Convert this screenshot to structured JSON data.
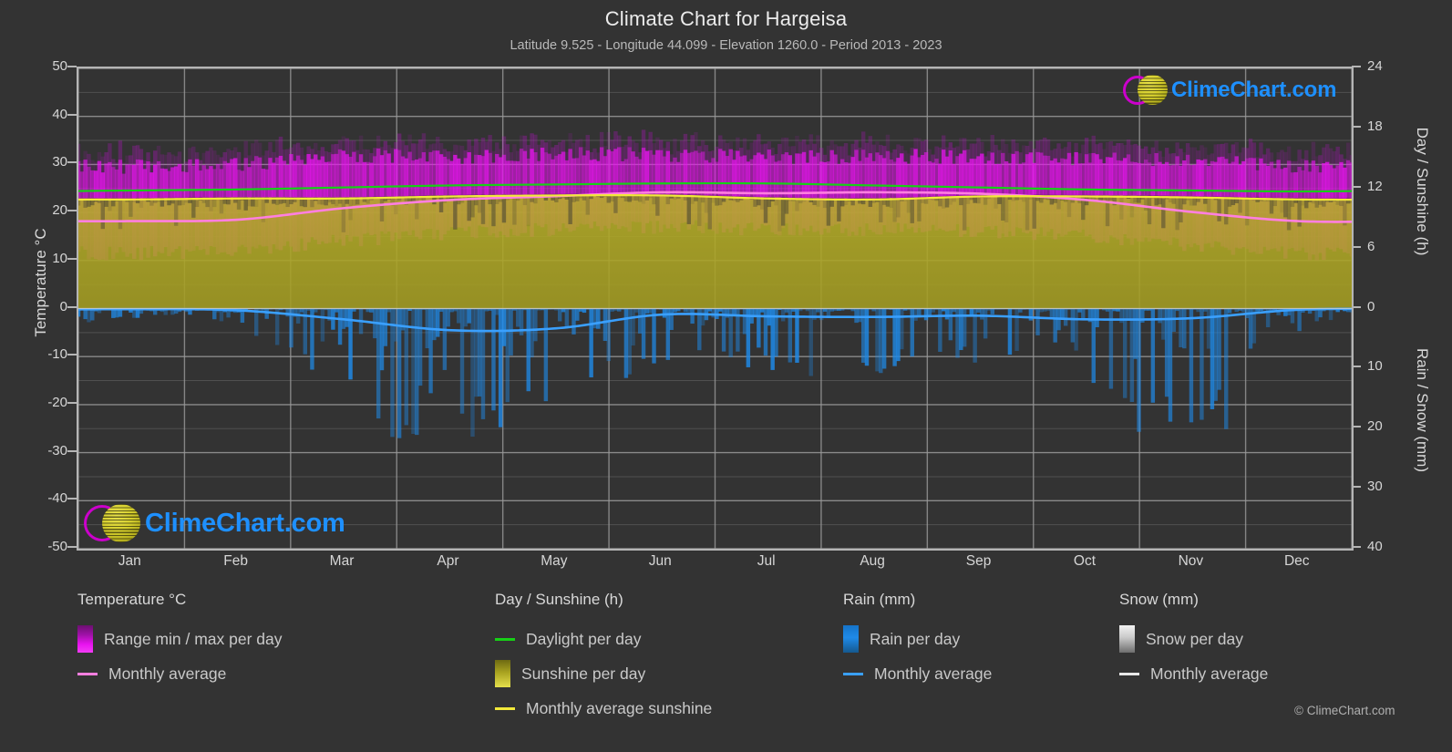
{
  "header": {
    "title": "Climate Chart for Hargeisa",
    "subtitle": "Latitude 9.525 - Longitude 44.099 - Elevation 1260.0 - Period 2013 - 2023"
  },
  "axes": {
    "left_title": "Temperature °C",
    "right_top_title": "Day / Sunshine (h)",
    "right_bottom_title": "Rain / Snow (mm)"
  },
  "legend": {
    "temperature": {
      "heading": "Temperature °C",
      "items": [
        {
          "label": "Range min / max per day",
          "marker": "swatch",
          "color": "#e913f0"
        },
        {
          "label": "Monthly average",
          "marker": "line",
          "color": "#ff7fe0"
        }
      ]
    },
    "day_sunshine": {
      "heading": "Day / Sunshine (h)",
      "items": [
        {
          "label": "Daylight per day",
          "marker": "line",
          "color": "#16d016"
        },
        {
          "label": "Sunshine per day",
          "marker": "swatch",
          "color": "#b3ac23"
        },
        {
          "label": "Monthly average sunshine",
          "marker": "line",
          "color": "#f2e93a"
        }
      ]
    },
    "rain": {
      "heading": "Rain (mm)",
      "items": [
        {
          "label": "Rain per day",
          "marker": "swatch",
          "color": "#1f8ae8"
        },
        {
          "label": "Monthly average",
          "marker": "line",
          "color": "#3aa0ff"
        }
      ]
    },
    "snow": {
      "heading": "Snow (mm)",
      "items": [
        {
          "label": "Snow per day",
          "marker": "swatch",
          "color": "#dddddd"
        },
        {
          "label": "Monthly average",
          "marker": "line",
          "color": "#e8e8e8"
        }
      ]
    }
  },
  "watermark": {
    "text": "ClimeChart.com",
    "copyright": "© ClimeChart.com"
  },
  "chart_data": {
    "type": "area",
    "title": "Climate Chart for Hargeisa",
    "subtitle": "Latitude 9.525 - Longitude 44.099 - Elevation 1260.0 - Period 2013 - 2023",
    "location": "Hargeisa",
    "latitude": 9.525,
    "longitude": 44.099,
    "elevation": 1260.0,
    "period": "2013 - 2023",
    "grid": true,
    "legend_position": "bottom",
    "xlabel": "",
    "x_tick_labels": [
      "Jan",
      "Feb",
      "Mar",
      "Apr",
      "May",
      "Jun",
      "Jul",
      "Aug",
      "Sep",
      "Oct",
      "Nov",
      "Dec"
    ],
    "axis_left": {
      "label": "Temperature °C",
      "ylim": [
        -50,
        50
      ],
      "ticks": [
        50,
        40,
        30,
        20,
        10,
        0,
        -10,
        -20,
        -30,
        -40,
        -50
      ]
    },
    "axis_right_top": {
      "label": "Day / Sunshine (h)",
      "ylim": [
        0,
        24
      ],
      "ticks": [
        24,
        18,
        12,
        6,
        0
      ],
      "maps_to_temperature": [
        0,
        50
      ]
    },
    "axis_right_bottom": {
      "label": "Rain / Snow (mm)",
      "ylim": [
        0,
        40
      ],
      "ticks": [
        0,
        10,
        20,
        30,
        40
      ],
      "maps_to_temperature": [
        0,
        -50
      ]
    },
    "series": [
      {
        "name": "Range min / max per day",
        "type": "band",
        "unit": "°C",
        "color": "#e913f0",
        "monthly_max": [
          29.5,
          30.0,
          31.5,
          31.5,
          32.0,
          32.0,
          31.5,
          31.5,
          31.5,
          31.0,
          30.5,
          29.5
        ],
        "monthly_min": [
          11.5,
          12.0,
          14.0,
          15.5,
          16.5,
          17.0,
          16.5,
          16.5,
          16.0,
          15.0,
          13.0,
          11.5
        ]
      },
      {
        "name": "Monthly average (temperature)",
        "type": "line",
        "unit": "°C",
        "color": "#ff7fe0",
        "values": [
          18.2,
          18.5,
          20.9,
          22.6,
          23.4,
          24.2,
          24.0,
          24.2,
          23.9,
          22.6,
          20.1,
          18.2
        ]
      },
      {
        "name": "Daylight per day",
        "type": "line",
        "unit": "h",
        "color": "#16d016",
        "values": [
          11.8,
          11.9,
          12.1,
          12.3,
          12.4,
          12.5,
          12.5,
          12.3,
          12.1,
          11.9,
          11.8,
          11.7
        ]
      },
      {
        "name": "Sunshine per day",
        "type": "area",
        "unit": "h",
        "color": "#b3ac23",
        "values": [
          10.9,
          11.0,
          11.0,
          11.2,
          11.3,
          11.3,
          11.0,
          10.9,
          11.2,
          11.2,
          11.1,
          10.9
        ]
      },
      {
        "name": "Monthly average sunshine",
        "type": "line",
        "unit": "h",
        "color": "#f2e93a",
        "values": [
          10.9,
          11.0,
          11.0,
          11.2,
          11.3,
          11.3,
          11.0,
          10.9,
          11.2,
          11.2,
          11.1,
          10.9
        ]
      },
      {
        "name": "Rain per day",
        "type": "bars",
        "unit": "mm",
        "color": "#1f8ae8",
        "direction": "down",
        "monthly_peak": [
          1.5,
          3.0,
          14.0,
          26.0,
          18.0,
          9.0,
          12.0,
          10.0,
          9.0,
          12.0,
          24.0,
          4.0
        ]
      },
      {
        "name": "Monthly average (rain)",
        "type": "line",
        "unit": "mm",
        "color": "#3aa0ff",
        "values": [
          0.1,
          0.3,
          1.8,
          3.6,
          3.3,
          1.0,
          1.3,
          1.4,
          1.2,
          1.8,
          1.6,
          0.2
        ]
      },
      {
        "name": "Snow per day",
        "type": "bars",
        "unit": "mm",
        "color": "#dddddd",
        "monthly_peak": [
          0,
          0,
          0,
          0,
          0,
          0,
          0,
          0,
          0,
          0,
          0,
          0
        ]
      },
      {
        "name": "Monthly average (snow)",
        "type": "line",
        "unit": "mm",
        "color": "#e8e8e8",
        "values": [
          0,
          0,
          0,
          0,
          0,
          0,
          0,
          0,
          0,
          0,
          0,
          0
        ]
      }
    ]
  }
}
